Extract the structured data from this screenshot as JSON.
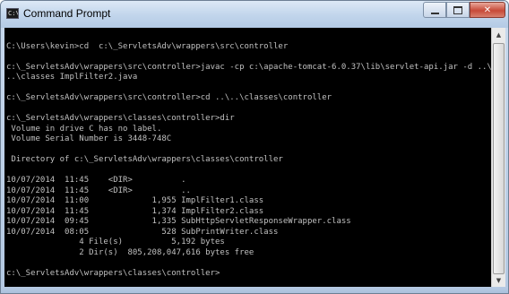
{
  "window": {
    "title": "Command Prompt",
    "icon_text": "C:\\",
    "icon": "console-icon",
    "buttons": {
      "minimize": "minimize-icon",
      "maximize": "maximize-icon",
      "close": "close-icon",
      "close_glyph": "✕"
    }
  },
  "scrollbar": {
    "up_glyph": "▲",
    "down_glyph": "▼"
  },
  "console": {
    "lines": [
      "",
      "C:\\Users\\kevin>cd  c:\\_ServletsAdv\\wrappers\\src\\controller",
      "",
      "c:\\_ServletsAdv\\wrappers\\src\\controller>javac -cp c:\\apache-tomcat-6.0.37\\lib\\servlet-api.jar -d ..\\",
      "..\\classes ImplFilter2.java",
      "",
      "c:\\_ServletsAdv\\wrappers\\src\\controller>cd ..\\..\\classes\\controller",
      "",
      "c:\\_ServletsAdv\\wrappers\\classes\\controller>dir",
      " Volume in drive C has no label.",
      " Volume Serial Number is 3448-748C",
      "",
      " Directory of c:\\_ServletsAdv\\wrappers\\classes\\controller",
      "",
      "10/07/2014  11:45    <DIR>          .",
      "10/07/2014  11:45    <DIR>          ..",
      "10/07/2014  11:00             1,955 ImplFilter1.class",
      "10/07/2014  11:45             1,374 ImplFilter2.class",
      "10/07/2014  09:45             1,335 SubHttpServletResponseWrapper.class",
      "10/07/2014  08:05               528 SubPrintWriter.class",
      "               4 File(s)          5,192 bytes",
      "               2 Dir(s)  805,208,047,616 bytes free",
      "",
      "c:\\_ServletsAdv\\wrappers\\classes\\controller>"
    ]
  }
}
